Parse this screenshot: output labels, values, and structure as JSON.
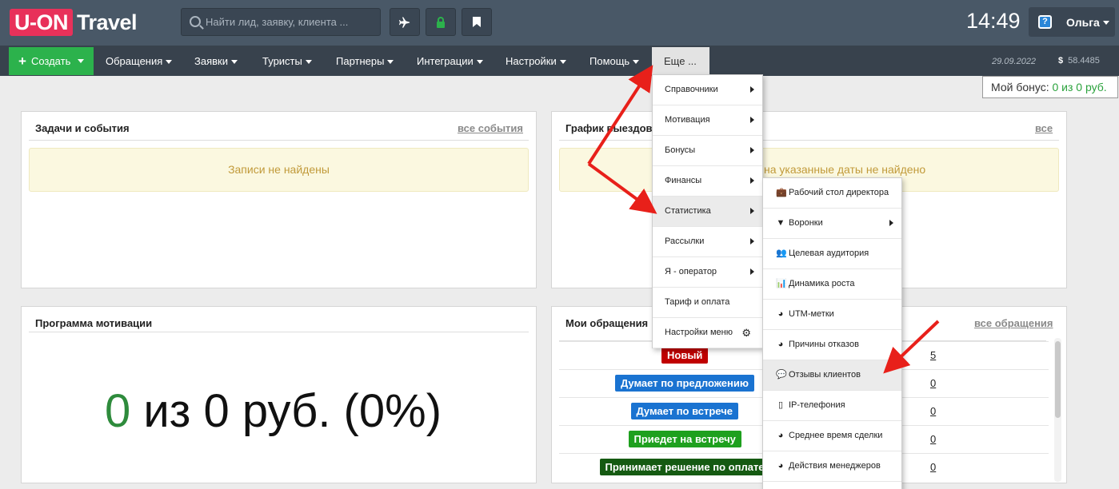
{
  "header": {
    "logo_mark": "U-ON",
    "logo_text": "Travel",
    "search_placeholder": "Найти лид, заявку, клиента ...",
    "clock": "14:49",
    "user_name": "Ольга",
    "help_label": "?",
    "icons": [
      "plane-icon",
      "lock-icon",
      "bookmark-icon"
    ]
  },
  "nav": {
    "create_label": "Создать",
    "items": [
      "Обращения",
      "Заявки",
      "Туристы",
      "Партнеры",
      "Интеграции",
      "Настройки",
      "Помощь"
    ],
    "more_label": "Еще ...",
    "date": "29.09.2022",
    "currency_symbol": "$",
    "rate": "58.4485"
  },
  "bonus": {
    "label": "Мой бонус:",
    "value": "0 из 0 руб."
  },
  "tasks": {
    "title": "Задачи и события",
    "link": "все события",
    "empty": "Записи не найдены"
  },
  "schedule": {
    "title": "График выездов",
    "link": "все",
    "empty": "на указанные даты не найдено"
  },
  "motivation": {
    "title": "Программа мотивации",
    "value_green": "0",
    "value_rest": " из 0 руб. (0%)"
  },
  "requests": {
    "title": "Мои обращения",
    "link": "все обращения",
    "rows": [
      {
        "label": "Новый",
        "count": "5",
        "color": "#c00000"
      },
      {
        "label": "Думает по предложению",
        "count": "0",
        "color": "#1a73d1"
      },
      {
        "label": "Думает по встрече",
        "count": "0",
        "color": "#1a73d1"
      },
      {
        "label": "Приедет на встречу",
        "count": "0",
        "color": "#1ea01e"
      },
      {
        "label": "Принимает решение по оплате",
        "count": "0",
        "color": "#155a12"
      }
    ]
  },
  "more_menu": {
    "items": [
      {
        "label": "Справочники",
        "submenu": true
      },
      {
        "label": "Мотивация",
        "submenu": true
      },
      {
        "label": "Бонусы",
        "submenu": true
      },
      {
        "label": "Финансы",
        "submenu": true
      },
      {
        "label": "Статистика",
        "submenu": true,
        "active": true
      },
      {
        "label": "Рассылки",
        "submenu": true
      },
      {
        "label": "Я - оператор",
        "submenu": true
      },
      {
        "label": "Тариф и оплата",
        "submenu": false
      },
      {
        "label": "Настройки меню",
        "submenu": false,
        "gear": true
      }
    ]
  },
  "stats_menu": {
    "items": [
      {
        "label": "Рабочий стол директора",
        "icon": "briefcase-icon",
        "glyph": "💼"
      },
      {
        "label": "Воронки",
        "icon": "funnel-icon",
        "glyph": "▼",
        "submenu": true
      },
      {
        "label": "Целевая аудитория",
        "icon": "users-icon",
        "glyph": "👥"
      },
      {
        "label": "Динамика роста",
        "icon": "bar-chart-icon",
        "glyph": "📊"
      },
      {
        "label": "UTM-метки",
        "icon": "pie-chart-icon",
        "glyph": "◕"
      },
      {
        "label": "Причины отказов",
        "icon": "pie-chart-icon",
        "glyph": "◕"
      },
      {
        "label": "Отзывы клиентов",
        "icon": "comments-icon",
        "glyph": "💬",
        "active": true
      },
      {
        "label": "IP-телефония",
        "icon": "phone-icon",
        "glyph": "▯"
      },
      {
        "label": "Среднее время сделки",
        "icon": "clock-icon",
        "glyph": "◕"
      },
      {
        "label": "Действия менеджеров",
        "icon": "pie-chart-icon",
        "glyph": "◕"
      }
    ]
  },
  "annotation_color": "#e8201a"
}
